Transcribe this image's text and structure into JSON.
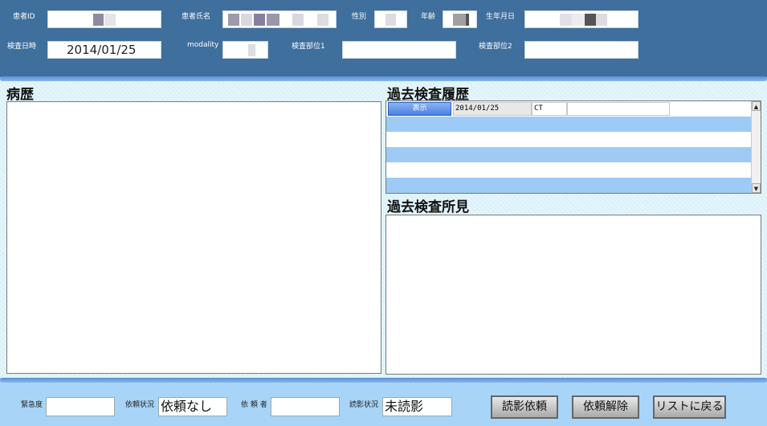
{
  "header": {
    "patient_id_label": "患者ID",
    "patient_name_label": "患者氏名",
    "sex_label": "性別",
    "age_label": "年齢",
    "birthdate_label": "生年月日",
    "exam_datetime_label": "検査日時",
    "exam_datetime_value": "2014/01/25",
    "modality_label": "modality",
    "exam_part1_label": "検査部位1",
    "exam_part2_label": "検査部位2"
  },
  "history": {
    "title": "病歴"
  },
  "past_exams": {
    "title": "過去検査履歴",
    "rows": [
      {
        "button_label": "表示",
        "date": "2014/01/25",
        "modality": "CT"
      }
    ]
  },
  "past_findings": {
    "title": "過去検査所見"
  },
  "footer": {
    "urgency_label": "緊急度",
    "request_status_label": "依頼状況",
    "request_status_value": "依頼なし",
    "requester_label": "依 頼 者",
    "reading_status_label": "読影状況",
    "reading_status_value": "未読影",
    "request_reading_button": "読影依頼",
    "cancel_request_button": "依頼解除",
    "back_to_list_button": "リストに戻る"
  },
  "colors": {
    "header_bg": "#3f6f9c",
    "footer_bg": "#a8d4f8",
    "row_highlight": "#9ecbf6",
    "show_button": "#4a80e0"
  }
}
